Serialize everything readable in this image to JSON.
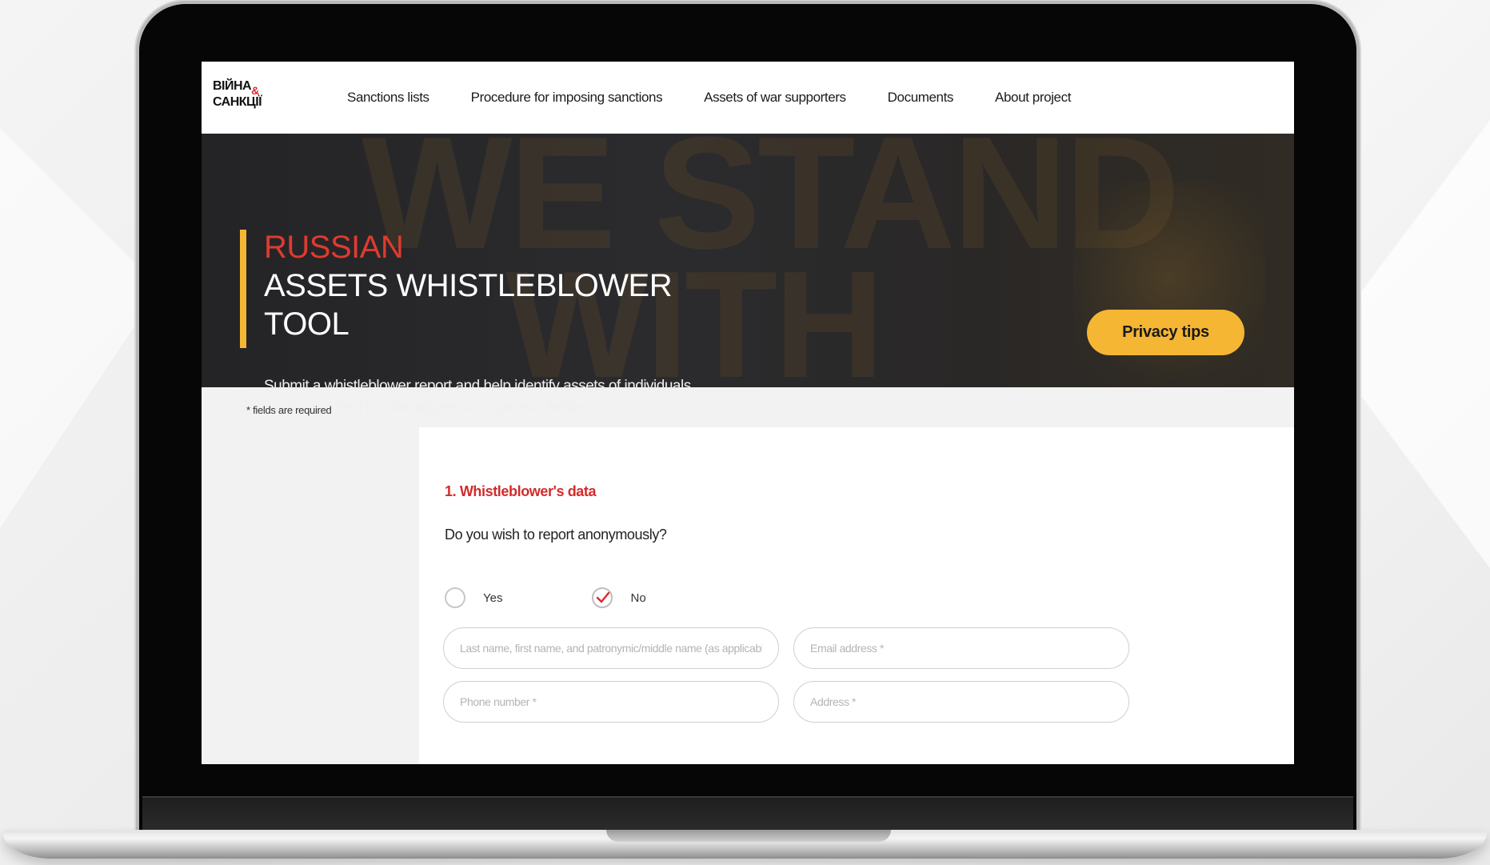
{
  "nav": {
    "logo_line1": "ВІЙНА",
    "logo_amp": "&",
    "logo_line2": "САНКЦІЇ",
    "links": [
      "Sanctions lists",
      "Procedure for imposing sanctions",
      "Assets of war supporters",
      "Documents",
      "About project"
    ]
  },
  "hero": {
    "title_accent": "RUSSIAN",
    "title_line2": "ASSETS WHISTLEBLOWER",
    "title_line3": "TOOL",
    "description": "Submit a whistleblower report and help identify assets of individuals involved in the Russian aggression against Ukraine.",
    "watermark_line1": "WE STAND",
    "watermark_line2": "WITH",
    "privacy_button": "Privacy tips"
  },
  "form": {
    "required_note": "* fields are required",
    "section_title": "1. Whistleblower's data",
    "question": "Do you wish to report anonymously?",
    "options": [
      {
        "label": "Yes",
        "checked": false
      },
      {
        "label": "No",
        "checked": true
      }
    ],
    "fields": {
      "full_name_placeholder": "Last name, first name, and patronymic/middle name (as applicable) *",
      "email_placeholder": "Email address *",
      "phone_placeholder": "Phone number *",
      "address_placeholder": "Address *"
    }
  },
  "colors": {
    "accent_red": "#e03a2f",
    "accent_yellow": "#f5b633",
    "hero_bg": "#2a2a2c"
  }
}
